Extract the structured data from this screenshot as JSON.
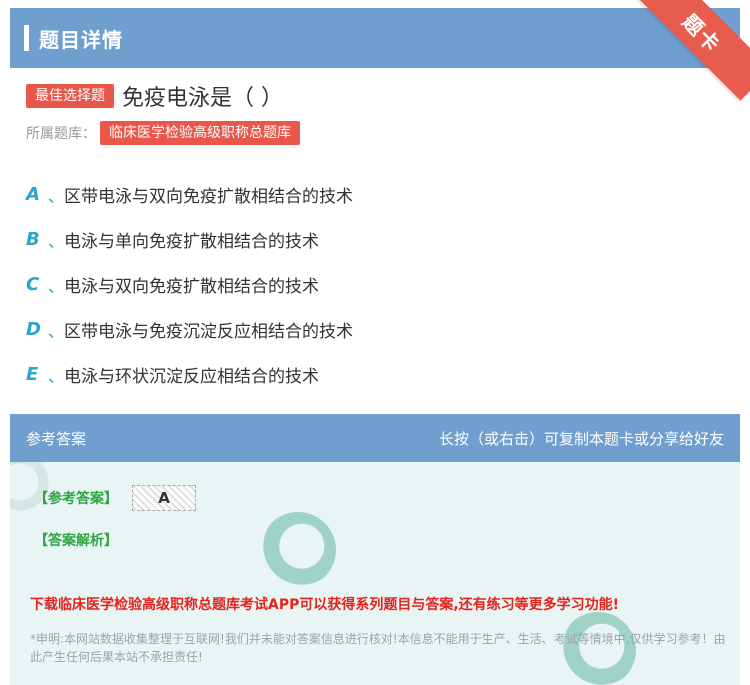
{
  "header": {
    "title": "题目详情",
    "corner": "题卡"
  },
  "question": {
    "type_tag": "最佳选择题",
    "text": "免疫电泳是（      ）",
    "bank_label": "所属题库：",
    "bank_name": "临床医学检验高级职称总题库"
  },
  "options": [
    {
      "letter": "A",
      "sep": "、",
      "text": "区带电泳与双向免疫扩散相结合的技术"
    },
    {
      "letter": "B",
      "sep": "、",
      "text": "电泳与单向免疫扩散相结合的技术"
    },
    {
      "letter": "C",
      "sep": "、",
      "text": "电泳与双向免疫扩散相结合的技术"
    },
    {
      "letter": "D",
      "sep": "、",
      "text": "区带电泳与免疫沉淀反应相结合的技术"
    },
    {
      "letter": "E",
      "sep": "、",
      "text": "电泳与环状沉淀反应相结合的技术"
    }
  ],
  "answer": {
    "head_left": "参考答案",
    "head_right": "长按（或右击）可复制本题卡或分享给好友",
    "answer_label": "【参考答案】",
    "answer_value": "A",
    "analysis_label": "【答案解析】",
    "promo": "下载临床医学检验高级职称总题库考试APP可以获得系列题目与答案,还有练习等更多学习功能!",
    "disclaimer": "*申明:本网站数据收集整理于互联网!我们并未能对答案信息进行核对!本信息不能用于生产、生活、考试等情境中,仅供学习参考！由此产生任何后果本站不承担责任!"
  },
  "colors": {
    "header": "#6f9fce",
    "tag": "#e8574a",
    "option_letter": "#2aa6c8",
    "label_green": "#2fa544",
    "promo_red": "#e5231c"
  }
}
